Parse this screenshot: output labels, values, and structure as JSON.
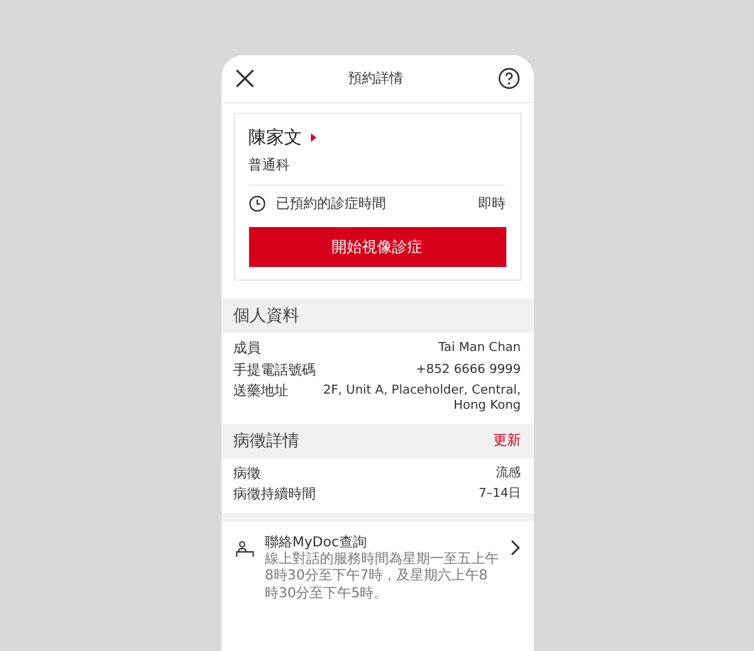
{
  "header": {
    "title": "預約詳情"
  },
  "doctor": {
    "name": "陳家文",
    "specialty": "普通科",
    "time_label": "已預約的診症時間",
    "time_value": "即時",
    "button": "開始視像診症"
  },
  "personal": {
    "title": "個人資料",
    "rows": [
      {
        "label": "成員",
        "value": "Tai Man Chan"
      },
      {
        "label": "手提電話號碼",
        "value": "+852 6666 9999"
      },
      {
        "label": "送藥地址",
        "value": "2F, Unit A, Placeholder, Central, Hong Kong"
      }
    ]
  },
  "symptoms": {
    "title": "病徵詳情",
    "action": "更新",
    "rows": [
      {
        "label": "病徵",
        "value": "流感"
      },
      {
        "label": "病徵持續時間",
        "value": "7–14日"
      }
    ]
  },
  "contact": {
    "title": "聯絡MyDoc查詢",
    "description": "線上對話的服務時間為星期一至五上午8時30分至下午7時，及星期六上午8時30分至下午5時。"
  }
}
